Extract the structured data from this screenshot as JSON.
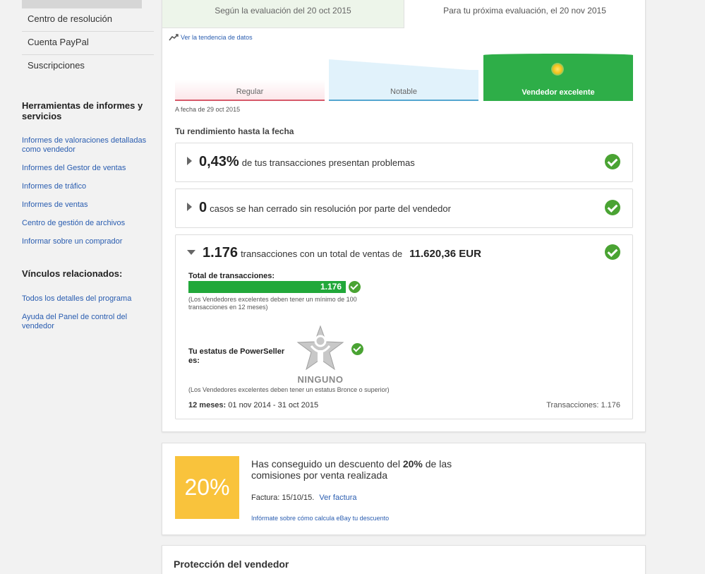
{
  "sidebar": {
    "nav": [
      "Centro de resolución",
      "Cuenta PayPal",
      "Suscripciones"
    ],
    "tools_heading": "Herramientas de informes y servicios",
    "tools_links": [
      "Informes de valoraciones detalladas como vendedor",
      "Informes del Gestor de ventas",
      "Informes de tráfico",
      "Informes de ventas",
      "Centro de gestión de archivos",
      "Informar sobre un comprador"
    ],
    "related_heading": "Vínculos relacionados:",
    "related_links": [
      "Todos los detalles del programa",
      "Ayuda del Panel de control del vendedor"
    ]
  },
  "evaluation": {
    "left_tab": "Según la evaluación del 20 oct 2015",
    "right_tab": "Para tu próxima evaluación, el 20 nov 2015",
    "trend_link": "Ver la tendencia de datos",
    "levels": [
      "Regular",
      "Notable",
      "Vendedor excelente"
    ],
    "as_of": "A fecha de 29 oct 2015",
    "section_title": "Tu rendimiento hasta la fecha"
  },
  "metrics": {
    "problems_value": "0,43%",
    "problems_text": "de tus transacciones presentan problemas",
    "cases_value": "0",
    "cases_text": "casos se han cerrado sin resolución por parte del vendedor",
    "tx_value": "1.176",
    "tx_text": "transacciones con un total de ventas de",
    "tx_amount": "11.620,36 EUR",
    "total_label": "Total de transacciones:",
    "total_bar_value": "1.176",
    "total_bar_fill": 1.0,
    "total_note": "(Los Vendedores excelentes deben tener un mínimo de 100 transacciones en 12 meses)",
    "powerseller_label": "Tu estatus de PowerSeller es:",
    "powerseller_status": "NINGUNO",
    "powerseller_note": "(Los Vendedores excelentes deben tener un estatus Bronce o superior)",
    "period_label": "12 meses:",
    "period_value": "01 nov 2014 - 31 oct 2015",
    "period_tx": "Transacciones: 1.176"
  },
  "discount": {
    "badge": "20%",
    "text_pre": "Has conseguido un descuento del",
    "text_pct": "20%",
    "text_post": "de las comisiones por venta realizada",
    "invoice_label": "Factura: 15/10/15.",
    "invoice_link": "Ver factura",
    "calc_link": "Infórmate sobre cómo calcula eBay tu descuento"
  },
  "protection": {
    "title": "Protección del vendedor"
  },
  "colors": {
    "link": "#2a5db0",
    "success": "#21a83a",
    "excellent": "#2eae48",
    "discount": "#f9c33c"
  }
}
